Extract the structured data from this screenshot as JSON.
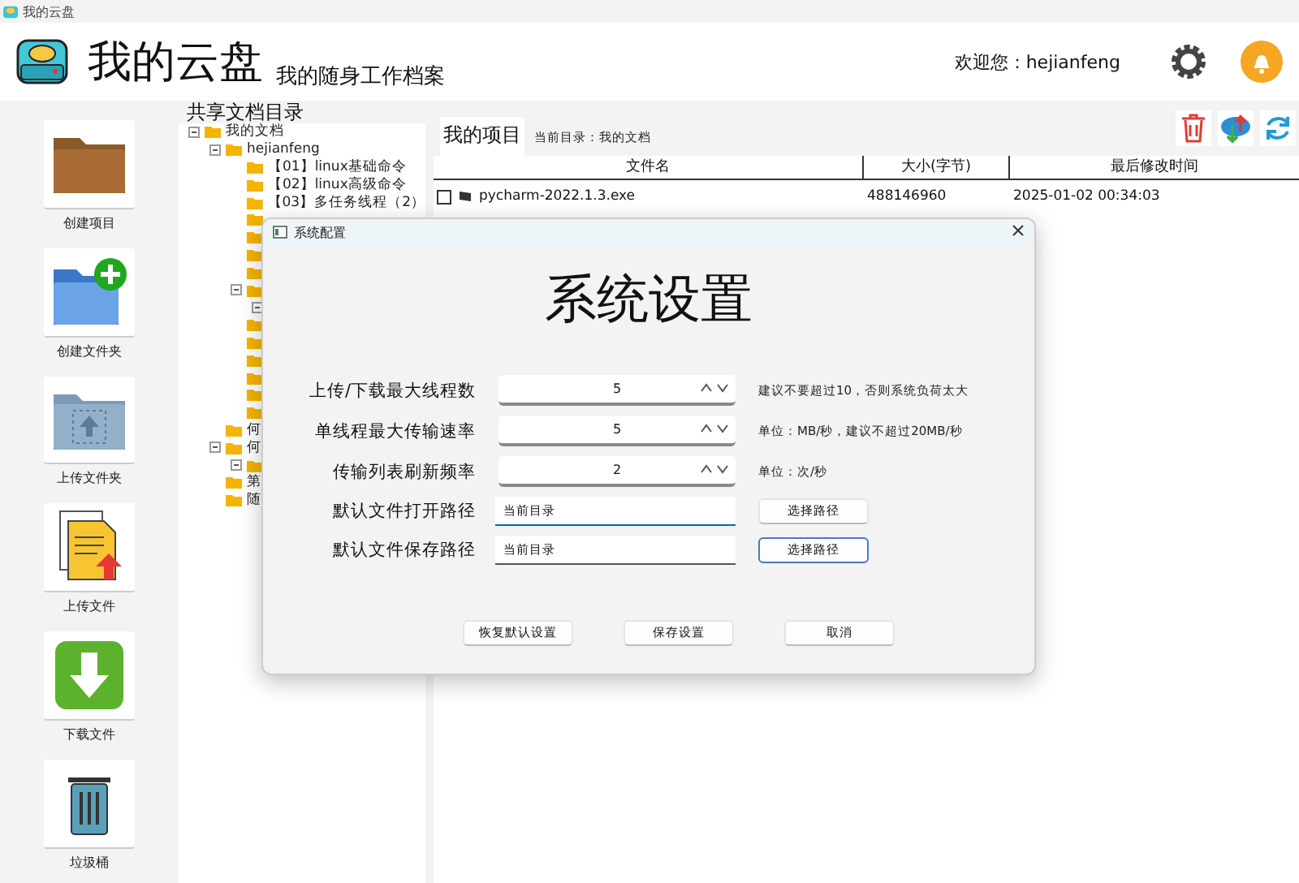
{
  "window": {
    "title": "我的云盘"
  },
  "header": {
    "app_name": "我的云盘",
    "subtitle": "我的随身工作档案",
    "welcome": "欢迎您：hejianfeng"
  },
  "toolbar": [
    {
      "label": "创建项目",
      "kind": "projects"
    },
    {
      "label": "创建文件夹",
      "kind": "new-folder"
    },
    {
      "label": "上传文件夹",
      "kind": "upload-folder"
    },
    {
      "label": "上传文件",
      "kind": "upload-file"
    },
    {
      "label": "下载文件",
      "kind": "download"
    },
    {
      "label": "垃圾桶",
      "kind": "trash"
    }
  ],
  "tree": {
    "title": "共享文档目录",
    "nodes": [
      {
        "kind": "folder",
        "label": "我的文档",
        "expanded": true,
        "children": [
          {
            "kind": "folder",
            "label": "hejianfeng",
            "expanded": true,
            "children": [
              {
                "kind": "folder",
                "label": "【01】linux基础命令"
              },
              {
                "kind": "folder",
                "label": "【02】linux高级命令"
              },
              {
                "kind": "folder",
                "label": "【03】多任务线程（2）"
              },
              {
                "kind": "folder"
              },
              {
                "kind": "folder"
              },
              {
                "kind": "folder"
              },
              {
                "kind": "folder"
              },
              {
                "kind": "folder",
                "expanded": true,
                "children": [
                  {
                    "expanded": true
                  }
                ]
              },
              {
                "kind": "folder"
              },
              {
                "kind": "folder"
              },
              {
                "kind": "folder"
              },
              {
                "kind": "folder"
              },
              {
                "kind": "folder"
              },
              {
                "kind": "folder"
              }
            ]
          },
          {
            "kind": "folder",
            "label": "何"
          },
          {
            "kind": "folder",
            "label": "何",
            "expanded": true,
            "children": [
              {
                "kind": "folder",
                "expanded": true
              }
            ]
          },
          {
            "kind": "folder",
            "label": "第"
          },
          {
            "kind": "folder",
            "label": "随"
          }
        ]
      }
    ]
  },
  "project": {
    "tab": "我的项目",
    "current_dir": "当前目录：我的文档",
    "columns": [
      "文件名",
      "大小(字节)",
      "最后修改时间"
    ],
    "rows": [
      {
        "name": "pycharm-2022.1.3.exe",
        "size": "488146960",
        "modified": "2025-01-02 00:34:03",
        "checked": false
      }
    ]
  },
  "dialog": {
    "title": "系统配置",
    "heading": "系统设置",
    "fields": [
      {
        "kind": "spin",
        "label": "上传/下载最大线程数",
        "value": "5",
        "hint": "建议不要超过10，否则系统负荷太大"
      },
      {
        "kind": "spin",
        "label": "单线程最大传输速率",
        "value": "5",
        "hint": "单位：MB/秒，建议不超过20MB/秒"
      },
      {
        "kind": "spin",
        "label": "传输列表刷新频率",
        "value": "2",
        "hint": "单位：次/秒"
      },
      {
        "kind": "path",
        "label": "默认文件打开路径",
        "value": "当前目录",
        "button": "选择路径",
        "focused": true,
        "button_highlighted": false
      },
      {
        "kind": "path",
        "label": "默认文件保存路径",
        "value": "当前目录",
        "button": "选择路径",
        "focused": false,
        "button_highlighted": true
      }
    ],
    "buttons": [
      "恢复默认设置",
      "保存设置",
      "取消"
    ]
  }
}
